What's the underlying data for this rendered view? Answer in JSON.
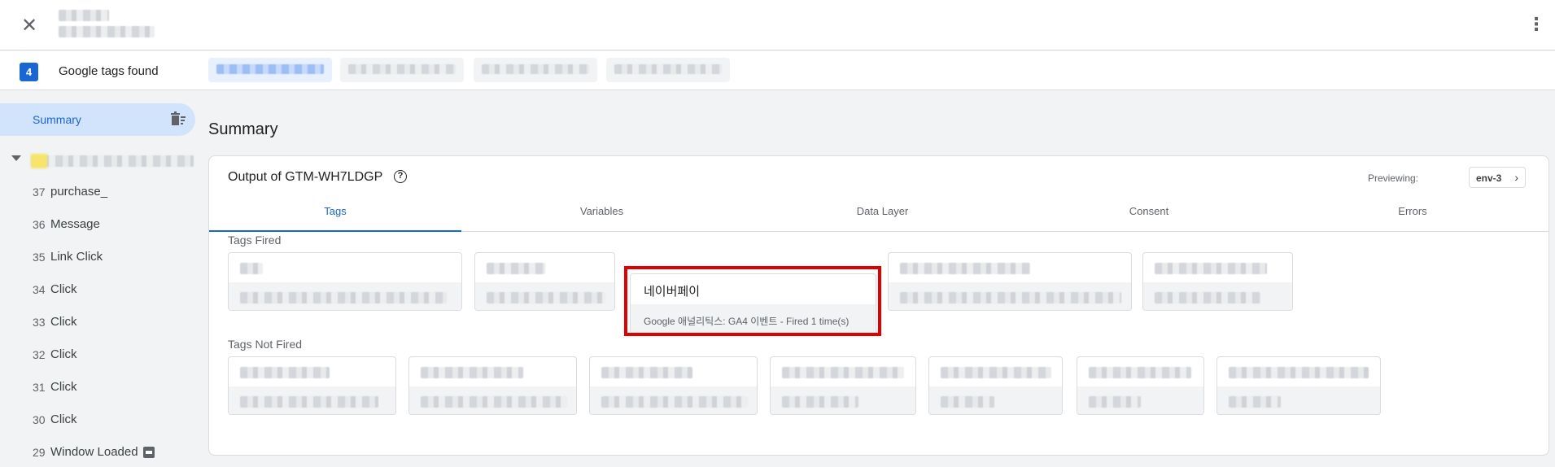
{
  "header": {
    "close_icon": "close-icon",
    "menu_icon": "more-vert-icon"
  },
  "tags_bar": {
    "count": "4",
    "label": "Google tags found",
    "accent": "#1967d2"
  },
  "sidebar": {
    "summary_label": "Summary",
    "events": [
      {
        "num": "37",
        "name": "purchase_"
      },
      {
        "num": "36",
        "name": "Message"
      },
      {
        "num": "35",
        "name": "Link Click"
      },
      {
        "num": "34",
        "name": "Click"
      },
      {
        "num": "33",
        "name": "Click"
      },
      {
        "num": "32",
        "name": "Click"
      },
      {
        "num": "31",
        "name": "Click"
      },
      {
        "num": "30",
        "name": "Click"
      },
      {
        "num": "29",
        "name": "Window Loaded"
      }
    ]
  },
  "main": {
    "title": "Summary",
    "output_title": "Output of GTM-WH7LDGP",
    "previewing_label": "Previewing:",
    "env": "env-3",
    "tabs": [
      "Tags",
      "Variables",
      "Data Layer",
      "Consent",
      "Errors"
    ],
    "tags_fired_label": "Tags Fired",
    "tags_not_fired_label": "Tags Not Fired",
    "highlighted_tag": {
      "name": "네이버페이",
      "detail": "Google 애널리틱스: GA4 이벤트 - Fired 1 time(s)"
    },
    "highlight_color": "#e00000"
  }
}
